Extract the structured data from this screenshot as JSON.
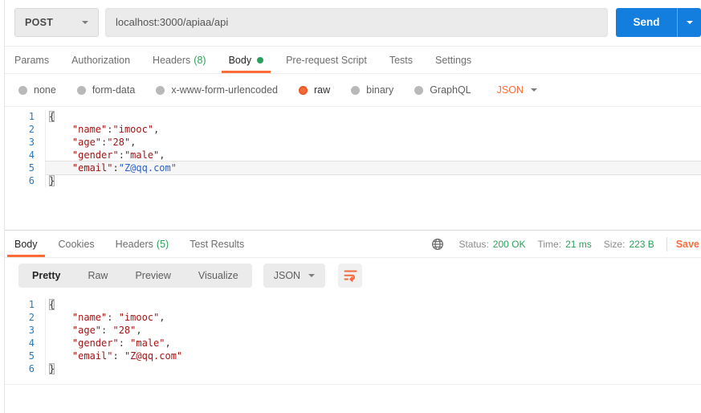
{
  "request": {
    "method": "POST",
    "url": "localhost:3000/apiaa/api",
    "send_label": "Send",
    "tabs": [
      {
        "label": "Params"
      },
      {
        "label": "Authorization"
      },
      {
        "label": "Headers",
        "count": "(8)"
      },
      {
        "label": "Body"
      },
      {
        "label": "Pre-request Script"
      },
      {
        "label": "Tests"
      },
      {
        "label": "Settings"
      }
    ],
    "active_tab": "Body",
    "body_types": [
      {
        "label": "none"
      },
      {
        "label": "form-data"
      },
      {
        "label": "x-www-form-urlencoded"
      },
      {
        "label": "raw"
      },
      {
        "label": "binary"
      },
      {
        "label": "GraphQL"
      }
    ],
    "selected_body_type": "raw",
    "raw_language": "JSON",
    "editor": {
      "lines": [
        {
          "n": 1,
          "tokens": [
            [
              "b",
              "{"
            ]
          ]
        },
        {
          "n": 2,
          "tokens": [
            [
              "p",
              "    "
            ],
            [
              "s",
              "\"name\""
            ],
            [
              "p",
              ":"
            ],
            [
              "s",
              "\"imooc\""
            ],
            [
              "p",
              ","
            ]
          ]
        },
        {
          "n": 3,
          "tokens": [
            [
              "p",
              "    "
            ],
            [
              "s",
              "\"age\""
            ],
            [
              "p",
              ":"
            ],
            [
              "s",
              "\"28\""
            ],
            [
              "p",
              ","
            ]
          ]
        },
        {
          "n": 4,
          "tokens": [
            [
              "p",
              "    "
            ],
            [
              "s",
              "\"gender\""
            ],
            [
              "p",
              ":"
            ],
            [
              "s",
              "\"male\""
            ],
            [
              "p",
              ","
            ]
          ]
        },
        {
          "n": 5,
          "active": true,
          "tokens": [
            [
              "p",
              "    "
            ],
            [
              "s",
              "\"email\""
            ],
            [
              "p",
              ":"
            ],
            [
              "v",
              "\"Z@qq.com\""
            ]
          ]
        },
        {
          "n": 6,
          "tokens": [
            [
              "b",
              "}"
            ]
          ]
        }
      ]
    }
  },
  "response": {
    "tabs": [
      {
        "label": "Body"
      },
      {
        "label": "Cookies"
      },
      {
        "label": "Headers",
        "count": "(5)"
      },
      {
        "label": "Test Results"
      }
    ],
    "active_tab": "Body",
    "meta": {
      "status_label": "Status:",
      "status_value": "200 OK",
      "time_label": "Time:",
      "time_value": "21 ms",
      "size_label": "Size:",
      "size_value": "223 B",
      "save_label": "Save"
    },
    "view_tabs": [
      {
        "label": "Pretty"
      },
      {
        "label": "Raw"
      },
      {
        "label": "Preview"
      },
      {
        "label": "Visualize"
      }
    ],
    "active_view_tab": "Pretty",
    "language": "JSON",
    "editor": {
      "lines": [
        {
          "n": 1,
          "tokens": [
            [
              "b",
              "{"
            ]
          ]
        },
        {
          "n": 2,
          "tokens": [
            [
              "p",
              "    "
            ],
            [
              "s",
              "\"name\""
            ],
            [
              "p",
              ": "
            ],
            [
              "s",
              "\"imooc\""
            ],
            [
              "p",
              ","
            ]
          ]
        },
        {
          "n": 3,
          "tokens": [
            [
              "p",
              "    "
            ],
            [
              "s",
              "\"age\""
            ],
            [
              "p",
              ": "
            ],
            [
              "s",
              "\"28\""
            ],
            [
              "p",
              ","
            ]
          ]
        },
        {
          "n": 4,
          "tokens": [
            [
              "p",
              "    "
            ],
            [
              "s",
              "\"gender\""
            ],
            [
              "p",
              ": "
            ],
            [
              "s",
              "\"male\""
            ],
            [
              "p",
              ","
            ]
          ]
        },
        {
          "n": 5,
          "tokens": [
            [
              "p",
              "    "
            ],
            [
              "s",
              "\"email\""
            ],
            [
              "p",
              ": "
            ],
            [
              "s",
              "\"Z@qq.com\""
            ]
          ]
        },
        {
          "n": 6,
          "tokens": [
            [
              "b",
              "}"
            ]
          ]
        }
      ]
    }
  },
  "colors": {
    "accent_orange": "#ff6c37",
    "send_blue": "#137ede",
    "status_green": "#2ca05a",
    "gutter_blue": "#2d7bbf",
    "string_red": "#a31515"
  },
  "icons": {
    "method_caret": "chevron-down",
    "send_caret": "chevron-down",
    "raw_language_caret": "chevron-down",
    "response_language_caret": "chevron-down",
    "globe": "globe",
    "wrap": "wrap-text",
    "unsaved_changes": "green-dot"
  }
}
